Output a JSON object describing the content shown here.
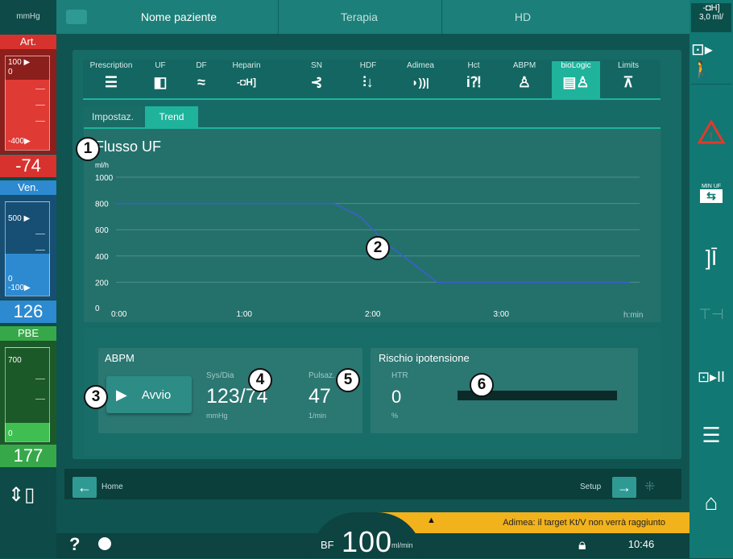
{
  "top": {
    "unit": "mmHg",
    "patient_tab": "Nome paziente",
    "therapy_tab": "Terapia",
    "mode_tab": "HD",
    "right_readout": "3,0 ml/"
  },
  "art": {
    "title": "Art.",
    "upper": "100 ▶",
    "zero": "0",
    "lower": "-400▶",
    "value": "-74"
  },
  "ven": {
    "title": "Ven.",
    "upper": "500 ▶",
    "zero": "0",
    "lower": "-100▶",
    "value": "126"
  },
  "pbe": {
    "title": "PBE",
    "upper": "700",
    "zero": "0",
    "value": "177"
  },
  "tabs": [
    {
      "label": "Prescription",
      "icon": "sliders-icon"
    },
    {
      "label": "UF",
      "icon": "uf-icon"
    },
    {
      "label": "DF",
      "icon": "df-wave-icon"
    },
    {
      "label": "Heparin",
      "icon": "syringe-icon"
    },
    {
      "label": "SN",
      "icon": "single-needle-icon"
    },
    {
      "label": "HDF",
      "icon": "hdf-icon"
    },
    {
      "label": "Adimea",
      "icon": "adimea-icon"
    },
    {
      "label": "Hct",
      "icon": "hct-icon"
    },
    {
      "label": "ABPM",
      "icon": "abpm-person-icon"
    },
    {
      "label": "bioLogic",
      "icon": "biologic-icon"
    },
    {
      "label": "Limits",
      "icon": "limits-icon"
    }
  ],
  "subtabs": {
    "settings": "Impostaz.",
    "trend": "Trend"
  },
  "chart_data": {
    "type": "line",
    "title": "Flusso UF",
    "ylabel": "ml/h",
    "xlabel": "h:min",
    "ylim": [
      0,
      1000
    ],
    "yticks": [
      "0",
      "200",
      "400",
      "600",
      "800",
      "1000"
    ],
    "xticks": [
      "0:00",
      "1:00",
      "2:00",
      "3:00"
    ],
    "x": [
      0,
      1.0,
      1.7,
      1.9,
      2.1,
      2.5,
      3.0,
      4.0
    ],
    "values": [
      800,
      800,
      800,
      700,
      500,
      200,
      200,
      200
    ],
    "line_color": "#3a5fd0"
  },
  "abpm": {
    "title": "ABPM",
    "start_label": "Avvio",
    "sysdia_label": "Sys/Dia",
    "sysdia_value": "123/74",
    "sysdia_unit": "mmHg",
    "pulse_label": "Pulsaz.",
    "pulse_value": "47",
    "pulse_unit": "1/min"
  },
  "risk": {
    "title": "Rischio ipotensione",
    "htr_label": "HTR",
    "htr_value": "0",
    "htr_unit": "%"
  },
  "markers": [
    "1",
    "2",
    "3",
    "4",
    "5",
    "6"
  ],
  "nav": {
    "home": "Home",
    "setup": "Setup"
  },
  "warning": "Adimea: il target Kt/V non verrà raggiunto",
  "bf": {
    "label": "BF",
    "value": "100",
    "unit": "ml/min"
  },
  "clock": "10:46",
  "colors": {
    "art": "#d8322e",
    "ven": "#2d8ad0",
    "pbe": "#37a84a",
    "accent": "#1fb39c",
    "warning": "#f2b21b"
  }
}
